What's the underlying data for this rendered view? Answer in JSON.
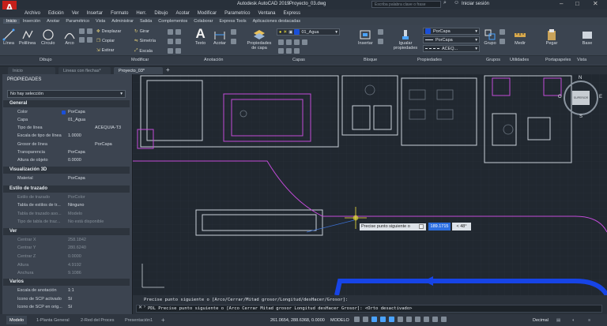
{
  "title_bar": {
    "app_title": "Autodesk AutoCAD 2019",
    "file_title": "Proyecto_03.dwg",
    "search_placeholder": "Escriba palabra clave o frase",
    "signin_label": "Iniciar sesión"
  },
  "menu": [
    "Archivo",
    "Edición",
    "Ver",
    "Insertar",
    "Formato",
    "Herr.",
    "Dibujo",
    "Acotar",
    "Modificar",
    "Parametrico",
    "Ventana",
    "Express"
  ],
  "ribbon_tabs": [
    "Inicio",
    "Inserción",
    "Anotar",
    "Paramétrico",
    "Vista",
    "Administrar",
    "Salida",
    "Complementos",
    "Colaborar",
    "Express Tools",
    "Aplicaciones destacadas"
  ],
  "ribbon": {
    "draw": {
      "line": "Línea",
      "polyline": "Polilínea",
      "circle": "Círculo",
      "arc": "Arco"
    },
    "modify": {
      "move": "Desplazar",
      "rotate": "Girar",
      "copy": "Copiar",
      "mirror": "Simetría",
      "stretch": "Estirar",
      "scale": "Escala"
    },
    "annotation": {
      "text": "Texto",
      "dimension": "Acotar"
    },
    "layers": {
      "properties": "Propiedades de capa",
      "current_layer": "01_Agua"
    },
    "block": {
      "insert": "Insertar"
    },
    "properties": {
      "match": "Igualar propiedades",
      "color": "PorCapa",
      "lineweight": "PorCapa",
      "linetype": "ACEQ..."
    },
    "group": "Grupo",
    "utilities": "Utilidades",
    "measure": "Medir",
    "clipboard": "Pegar",
    "base": "Base"
  },
  "panel_labels": [
    "Dibujo",
    "Modificar",
    "Anotación",
    "Capas",
    "Bloque",
    "Propiedades",
    "Grupos",
    "Utilidades",
    "Portapapeles",
    "Vista"
  ],
  "doc_tabs": [
    "Inicio",
    "Lineas con flechas*",
    "Proyecto_03*"
  ],
  "properties_palette": {
    "title": "PROPIEDADES",
    "selection": "No hay selección",
    "sections": {
      "general": "General",
      "viz3d": "Visualización 3D",
      "plot": "Estilo de trazado",
      "view": "Ver",
      "misc": "Varios"
    },
    "general": [
      {
        "k": "Color",
        "v": "PorCapa"
      },
      {
        "k": "Capa",
        "v": "01_Agua"
      },
      {
        "k": "Tipo de línea",
        "v": "ACEQUIA-T3"
      },
      {
        "k": "Escala de tipo de línea",
        "v": "1.0000"
      },
      {
        "k": "Grosor de línea",
        "v": "PorCapa"
      },
      {
        "k": "Transparencia",
        "v": "PorCapa"
      },
      {
        "k": "Altura de objeto",
        "v": "0.0000"
      }
    ],
    "viz3d": [
      {
        "k": "Material",
        "v": "PorCapa"
      }
    ],
    "plot": [
      {
        "k": "Estilo de trazado",
        "v": "PorColor"
      },
      {
        "k": "Tabla de estilos de tr...",
        "v": "Ninguno"
      },
      {
        "k": "Tabla de trazado aso...",
        "v": "Modelo"
      },
      {
        "k": "Tipo de tabla de traz...",
        "v": "No está disponible"
      }
    ],
    "view": [
      {
        "k": "Centrar X",
        "v": "258.1842"
      },
      {
        "k": "Centrar Y",
        "v": "280.6240"
      },
      {
        "k": "Centrar Z",
        "v": "0.0000"
      },
      {
        "k": "Altura",
        "v": "4.9192"
      },
      {
        "k": "Anchura",
        "v": "9.1086"
      }
    ],
    "misc": [
      {
        "k": "Escala de anotación",
        "v": "1:1"
      },
      {
        "k": "Icono de SCP activado",
        "v": "Sí"
      },
      {
        "k": "Icono de SCP en orig...",
        "v": "Sí"
      }
    ]
  },
  "viewcube": {
    "n": "N",
    "s": "S",
    "e": "E",
    "o": "O",
    "face": "SUPERIOR"
  },
  "tooltip": {
    "prompt": "Precise punto siguiente o",
    "distance": "189.1715",
    "angle": "< 48°"
  },
  "command_history": "Precise punto siguiente o [Arco/Cerrar/Mitad grosor/Longitud/desHacer/Grosor]:",
  "command_line": "PDL Precise punto siguiente o [Arco Cerrar Mitad grosor Longitud desHacer Grosor]: <Orto desactivado>",
  "status": {
    "layout_tabs": [
      "Modelo",
      "1-Planta General",
      "2-Red del Proces",
      "Presentación1"
    ],
    "coords": "261.0654, 288.6368, 0.0000",
    "model": "MODELO",
    "units": "Decimal"
  },
  "colors": {
    "accent": "#1a4fd8",
    "polyline": "#1744e6",
    "magenta": "#c34bd9",
    "yellow": "#f2e23a"
  }
}
